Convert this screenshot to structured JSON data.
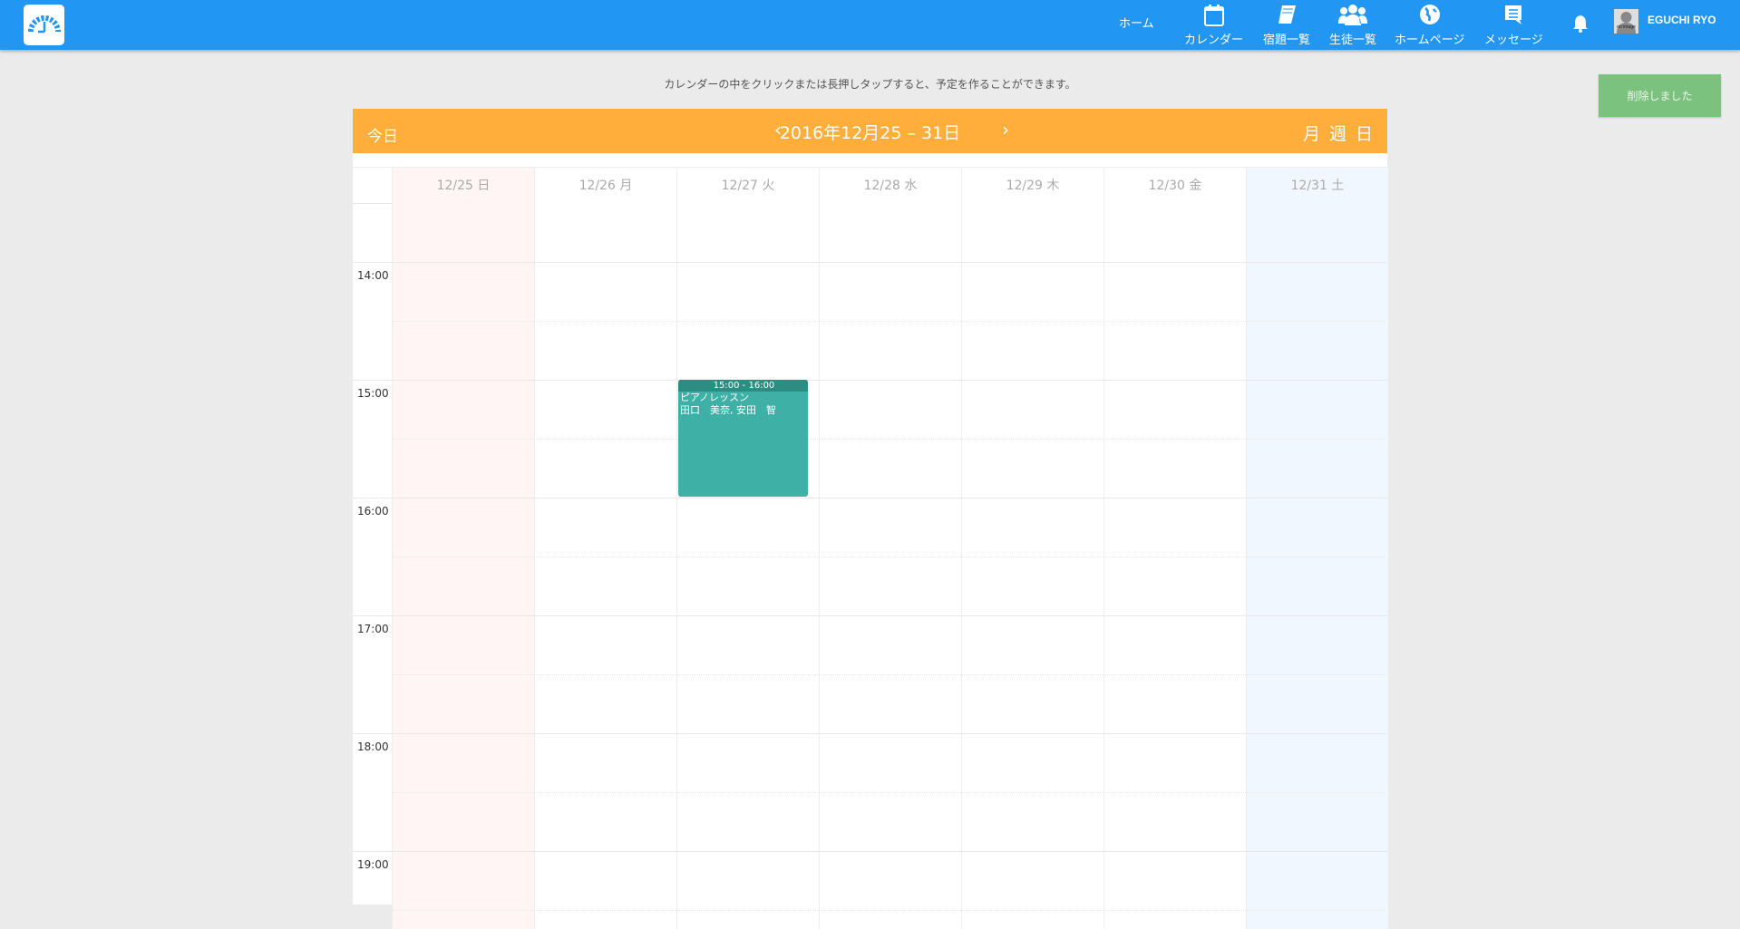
{
  "header": {
    "home": "ホーム",
    "nav": [
      {
        "label": "カレンダー",
        "icon": "calendar-icon"
      },
      {
        "label": "宿題一覧",
        "icon": "book-icon"
      },
      {
        "label": "生徒一覧",
        "icon": "users-icon"
      },
      {
        "label": "ホームページ",
        "icon": "globe-icon"
      },
      {
        "label": "メッセージ",
        "icon": "message-icon"
      }
    ],
    "user": "EGUCHI RYO",
    "avatar_text": "no image"
  },
  "notice": "カレンダーの中をクリックまたは長押しタップすると、予定を作ることができます。",
  "toast": "削除しました",
  "calendar": {
    "today": "今日",
    "range": "2016年12月25 – 31日",
    "prev": "‹",
    "next": "›",
    "views": [
      "月",
      "週",
      "日"
    ],
    "days": [
      {
        "label": "12/25 日"
      },
      {
        "label": "12/26 月"
      },
      {
        "label": "12/27 火"
      },
      {
        "label": "12/28 水"
      },
      {
        "label": "12/29 木"
      },
      {
        "label": "12/30 金"
      },
      {
        "label": "12/31 土"
      }
    ],
    "hours": [
      "14:00",
      "15:00",
      "16:00",
      "17:00",
      "18:00",
      "19:00"
    ],
    "events": [
      {
        "day": 2,
        "start": 15,
        "end": 16,
        "time": "15:00 - 16:00",
        "title": "ピアノレッスン",
        "people": "田口　美奈, 安田　智"
      }
    ]
  },
  "colors": {
    "header": "#2196f3",
    "toolbar": "#ffae3c",
    "sunday": "#fff5f5",
    "saturday": "#f0f7fe",
    "event": "#3eb0a5",
    "toast": "#7cc27f"
  }
}
